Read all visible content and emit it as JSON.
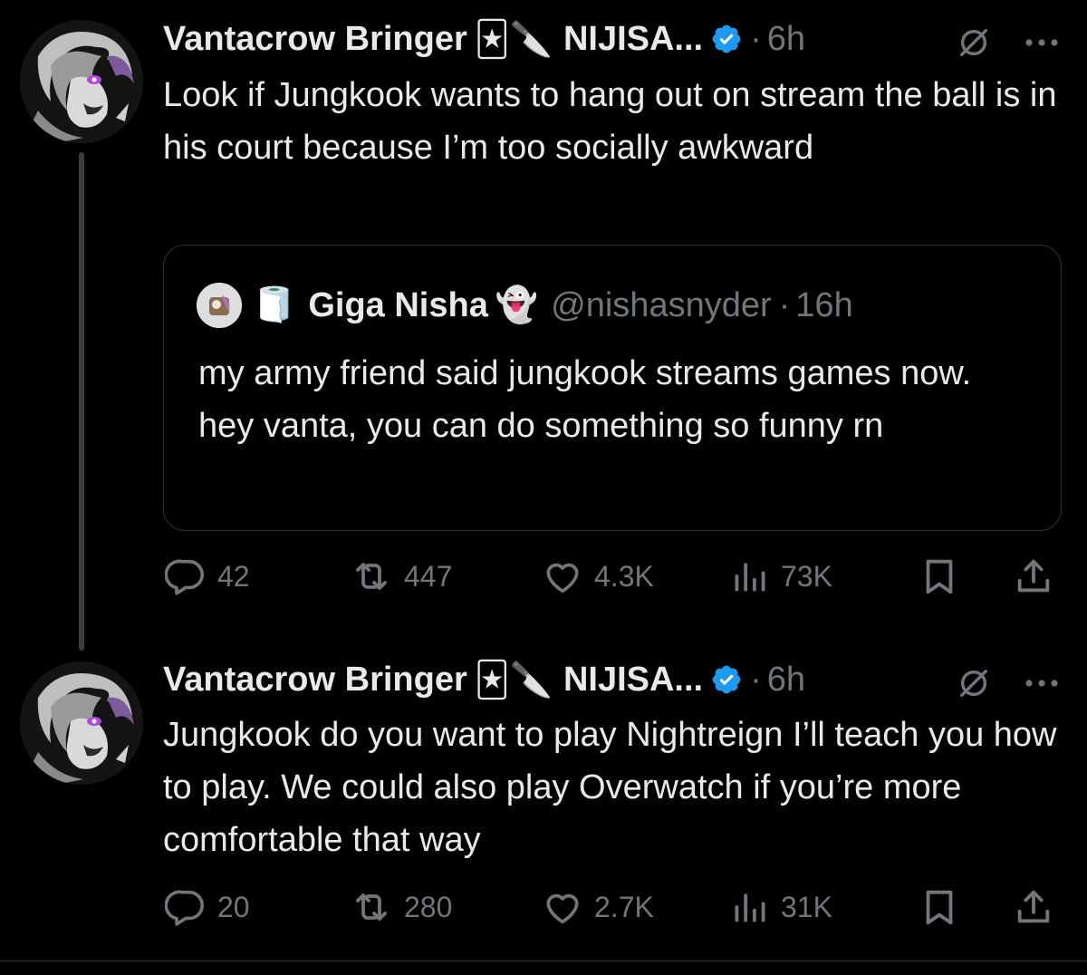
{
  "tweets": [
    {
      "author_name": "Vantacrow Bringer",
      "emojis": "🃏🔪",
      "handle_display": "NIJISA...",
      "time": "6h",
      "text": "Look if Jungkook wants to hang out on stream the ball is in his court because I’m too socially awkward",
      "quote": {
        "emoji_badge": "🧻",
        "author_name": "Giga Nisha",
        "author_emoji": "👻",
        "handle": "@nishasnyder",
        "time": "16h",
        "text": "my army friend said jungkook streams games now. hey vanta, you can do something so funny rn"
      },
      "stats": {
        "replies": "42",
        "reposts": "447",
        "likes": "4.3K",
        "views": "73K"
      }
    },
    {
      "author_name": "Vantacrow Bringer",
      "emojis": "🃏🔪",
      "handle_display": "NIJISA...",
      "time": "6h",
      "text": "Jungkook do you want to play Nightreign I’ll teach you how to play. We could also play Overwatch if you’re more comfortable that way",
      "stats": {
        "replies": "20",
        "reposts": "280",
        "likes": "2.7K",
        "views": "31K"
      }
    }
  ],
  "separator": "·",
  "colors": {
    "background": "#000000",
    "text": "#e7e9ea",
    "muted": "#71767b",
    "verified": "#1d9bf0",
    "border": "#2f3336"
  }
}
